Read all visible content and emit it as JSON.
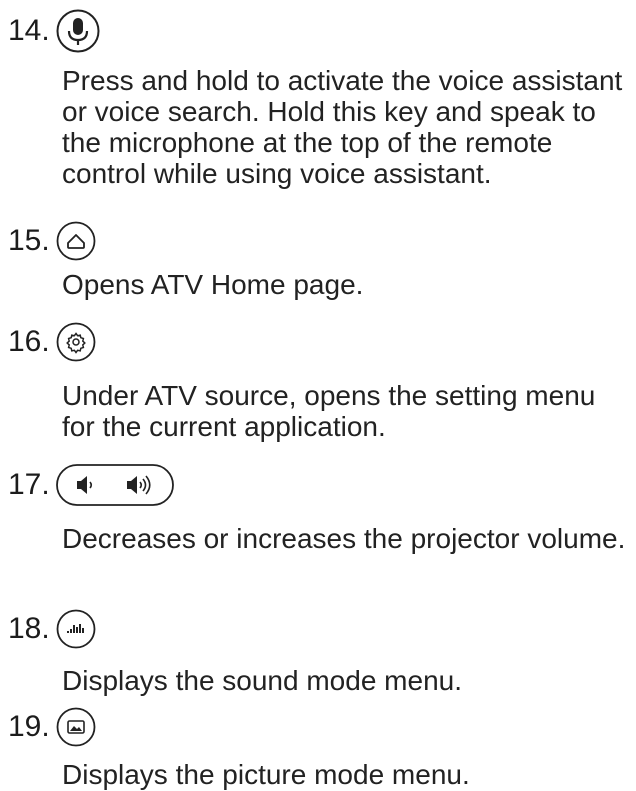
{
  "items": [
    {
      "number": "14.",
      "icon": "microphone-icon",
      "description": "Press and hold to activate the voice assistant or voice search. Hold this key and speak to the microphone at the top of the remote control while using voice assistant."
    },
    {
      "number": "15.",
      "icon": "home-icon",
      "description": "Opens ATV Home page."
    },
    {
      "number": "16.",
      "icon": "gear-icon",
      "description": "Under ATV source, opens the setting menu for the current application."
    },
    {
      "number": "17.",
      "icon": "volume-down-up-icon",
      "description": "Decreases or increases the projector volume."
    },
    {
      "number": "18.",
      "icon": "sound-mode-icon",
      "description": "Displays the sound mode menu."
    },
    {
      "number": "19.",
      "icon": "picture-mode-icon",
      "description": "Displays the picture mode menu."
    }
  ]
}
